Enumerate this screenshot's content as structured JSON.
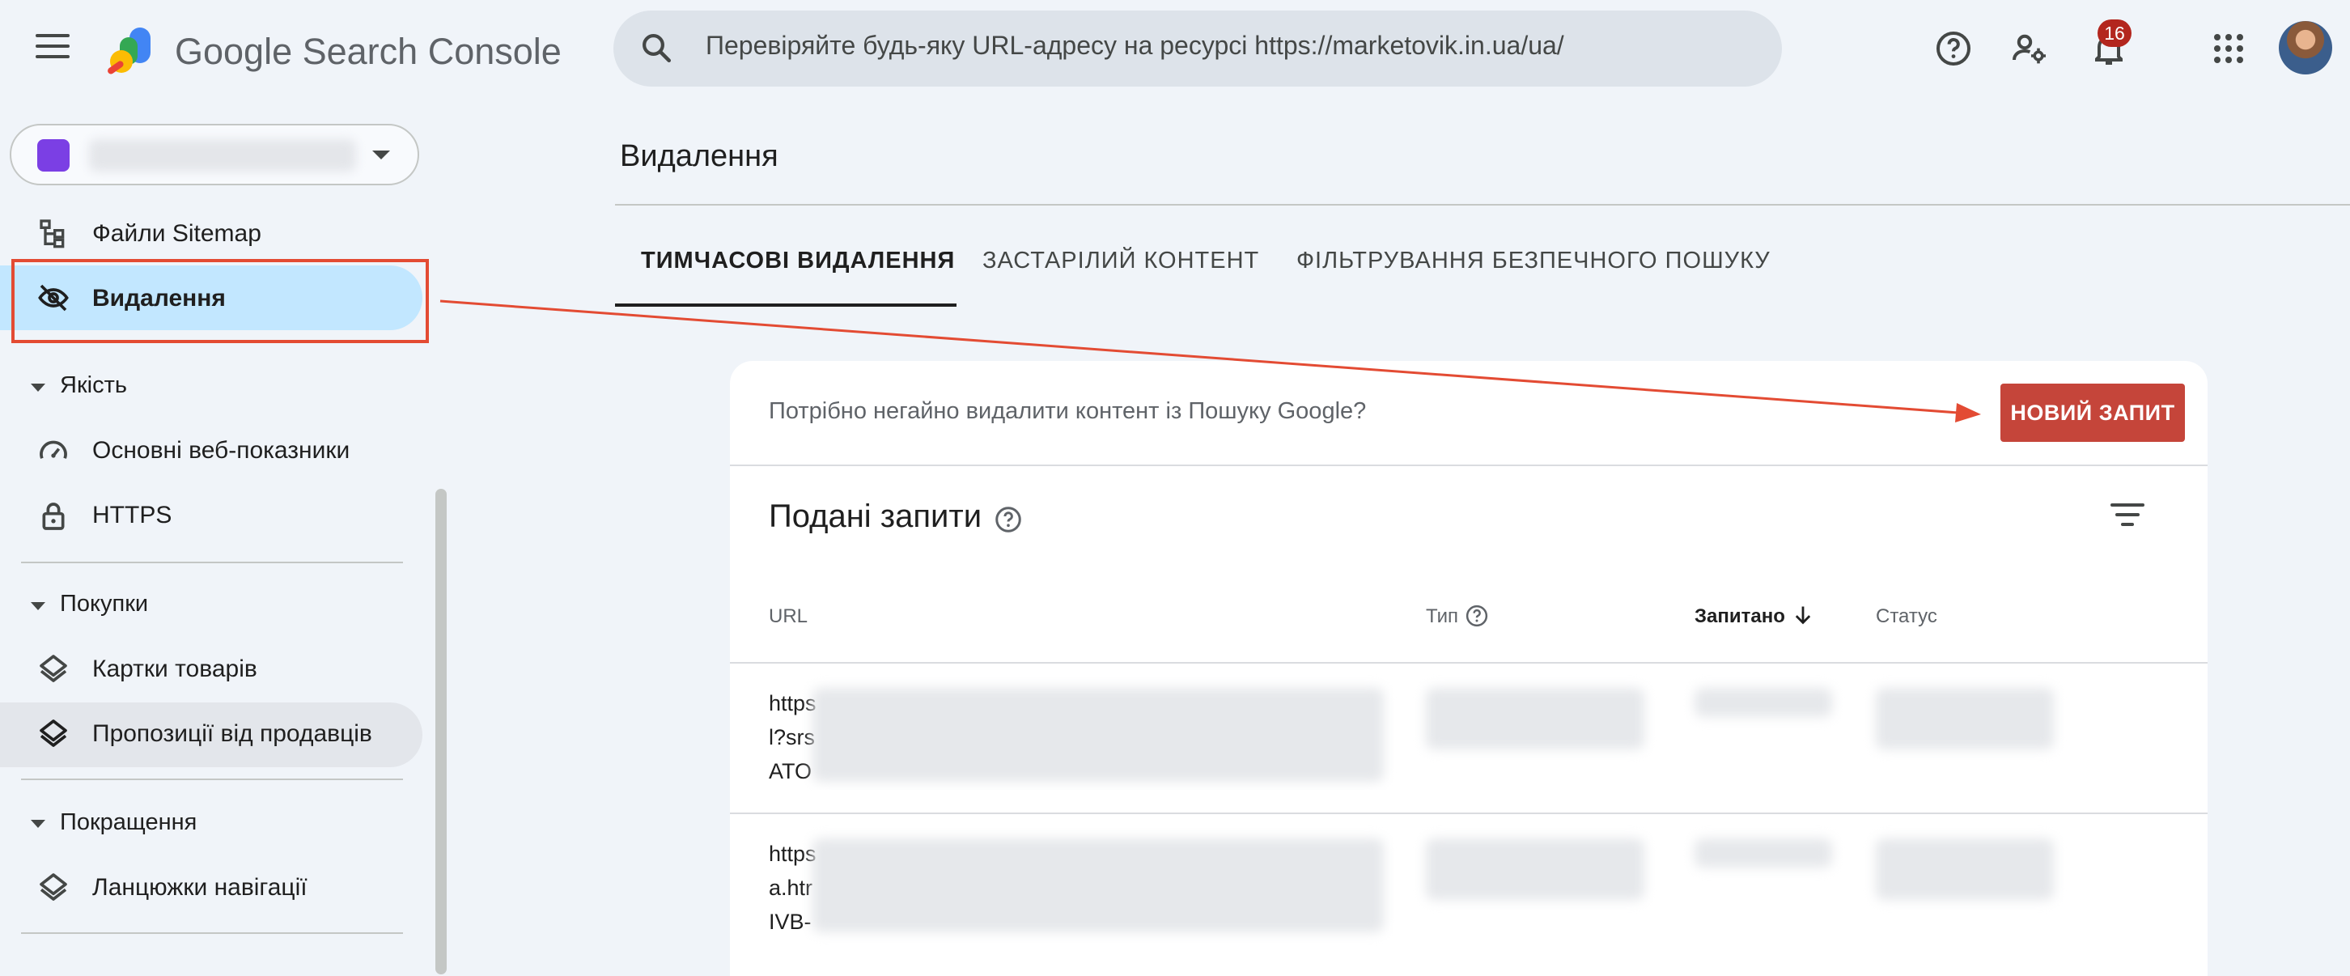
{
  "header": {
    "app_name": "Google Search Console",
    "search_placeholder": "Перевіряйте будь-яку URL-адресу на ресурсі https://marketovik.in.ua/ua/",
    "notifications_count": "16"
  },
  "sidebar": {
    "items": [
      {
        "label": "Файли Sitemap",
        "icon": "sitemap-icon"
      },
      {
        "label": "Видалення",
        "icon": "eye-off-icon",
        "selected": true
      },
      {
        "label": "Основні веб-показники",
        "icon": "speedometer-icon"
      },
      {
        "label": "HTTPS",
        "icon": "lock-icon"
      },
      {
        "label": "Картки товарів",
        "icon": "layers-icon"
      },
      {
        "label": "Пропозиції від продавців",
        "icon": "layers-icon",
        "hover": true
      },
      {
        "label": "Ланцюжки навігації",
        "icon": "layers-icon"
      }
    ],
    "sections": [
      "Якість",
      "Покупки",
      "Покращення"
    ]
  },
  "main": {
    "title": "Видалення",
    "tabs": [
      "ТИМЧАСОВІ ВИДАЛЕННЯ",
      "ЗАСТАРІЛИЙ КОНТЕНТ",
      "ФІЛЬТРУВАННЯ БЕЗПЕЧНОГО ПОШУКУ"
    ],
    "active_tab": 0,
    "prompt": "Потрібно негайно видалити контент із Пошуку Google?",
    "new_request_label": "НОВИЙ ЗАПИТ",
    "requests_title": "Подані запити",
    "columns": [
      "URL",
      "Тип",
      "Запитано",
      "Статус"
    ],
    "rows": [
      {
        "url_lines": [
          "https",
          "l?srs",
          "ATO"
        ]
      },
      {
        "url_lines": [
          "https",
          "a.htr",
          "IVB-"
        ]
      }
    ]
  },
  "colors": {
    "accent_red": "#c5453a",
    "annotation_red": "#e34b33",
    "selected_nav": "#c2e7ff",
    "badge": "#b3261e"
  }
}
